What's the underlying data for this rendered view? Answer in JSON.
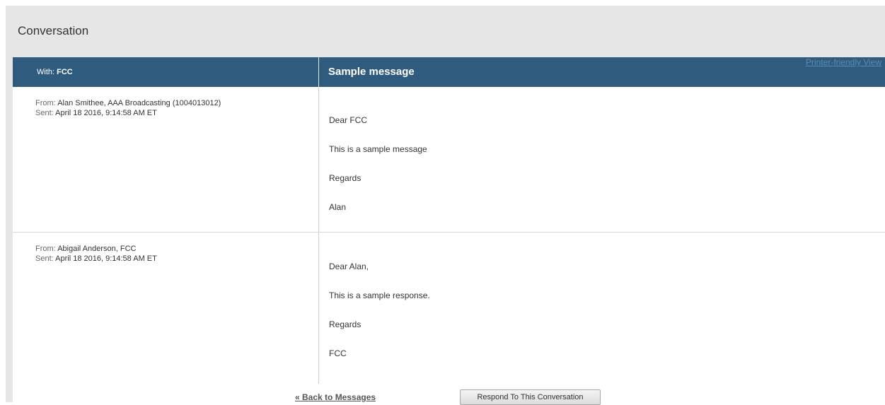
{
  "page": {
    "title": "Conversation"
  },
  "header": {
    "with_label": "With:",
    "with_value": "FCC",
    "subject": "Sample message",
    "printer_link": "Printer-friendly View"
  },
  "messages": [
    {
      "from_label": "From:",
      "from_value": "Alan Smithee, AAA Broadcasting (1004013012)",
      "sent_label": "Sent:",
      "sent_value": "April 18 2016,  9:14:58 AM ET",
      "body": [
        "Dear FCC",
        "This is a sample message",
        "Regards",
        "Alan"
      ]
    },
    {
      "from_label": "From:",
      "from_value": "Abigail Anderson, FCC",
      "sent_label": "Sent:",
      "sent_value": "April 18 2016,  9:14:58 AM ET",
      "body": [
        "Dear Alan,",
        "This is a sample response.",
        "Regards",
        "FCC"
      ]
    }
  ],
  "footer": {
    "back_link": "« Back to Messages",
    "respond_button": "Respond To This Conversation"
  },
  "colors": {
    "header_bg": "#2f5b7f",
    "page_bg": "#e6e6e6"
  }
}
